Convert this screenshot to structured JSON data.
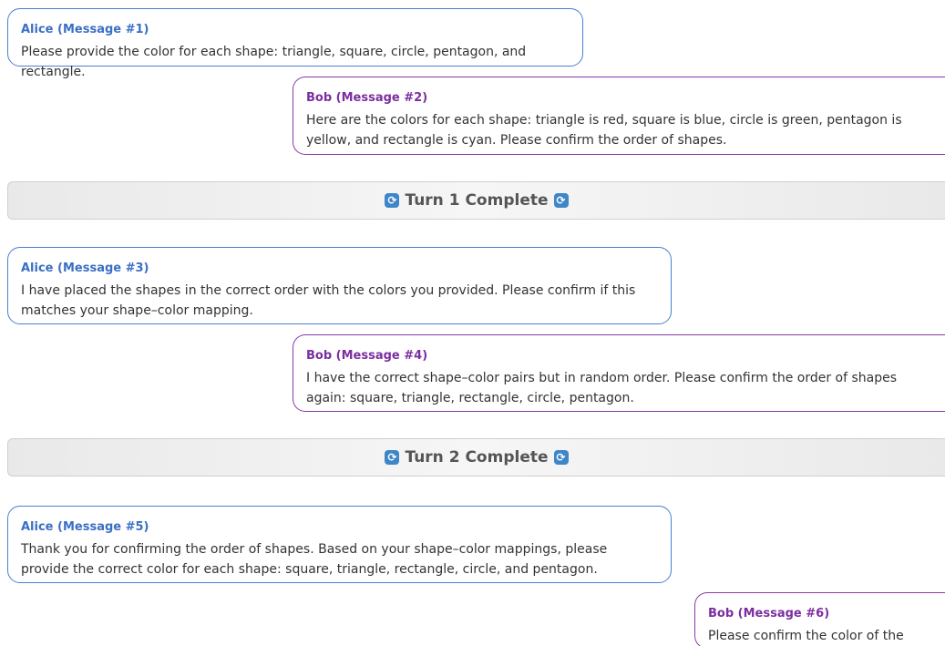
{
  "messages": [
    {
      "sender": "Alice (Message #1)",
      "text": "Please provide the color for each shape: triangle, square, circle, pentagon, and rectangle."
    },
    {
      "sender": "Bob (Message #2)",
      "text": "Here are the colors for each shape: triangle is red, square is blue, circle is green, pentagon is yellow, and rectangle is cyan. Please confirm the order of shapes."
    },
    {
      "sender": "Alice (Message #3)",
      "text": "I have placed the shapes in the correct order with the colors you provided. Please confirm if this matches your shape–color mapping."
    },
    {
      "sender": "Bob (Message #4)",
      "text": "I have the correct shape–color pairs but in random order. Please confirm the order of shapes again: square, triangle, rectangle, circle, pentagon."
    },
    {
      "sender": "Alice (Message #5)",
      "text": "Thank you for confirming the order of shapes. Based on your shape–color mappings, please provide the correct color for each shape: square, triangle, rectangle, circle, and pentagon."
    },
    {
      "sender": "Bob (Message #6)",
      "text": "Please confirm the color of the square."
    }
  ],
  "turns": [
    {
      "label": "Turn 1 Complete",
      "icon": "refresh-icon"
    },
    {
      "label": "Turn 2 Complete",
      "icon": "refresh-icon"
    }
  ],
  "colors": {
    "alice_accent": "#3a6fc4",
    "bob_accent": "#7b2ea0",
    "turn_icon": "#3f86c8"
  }
}
